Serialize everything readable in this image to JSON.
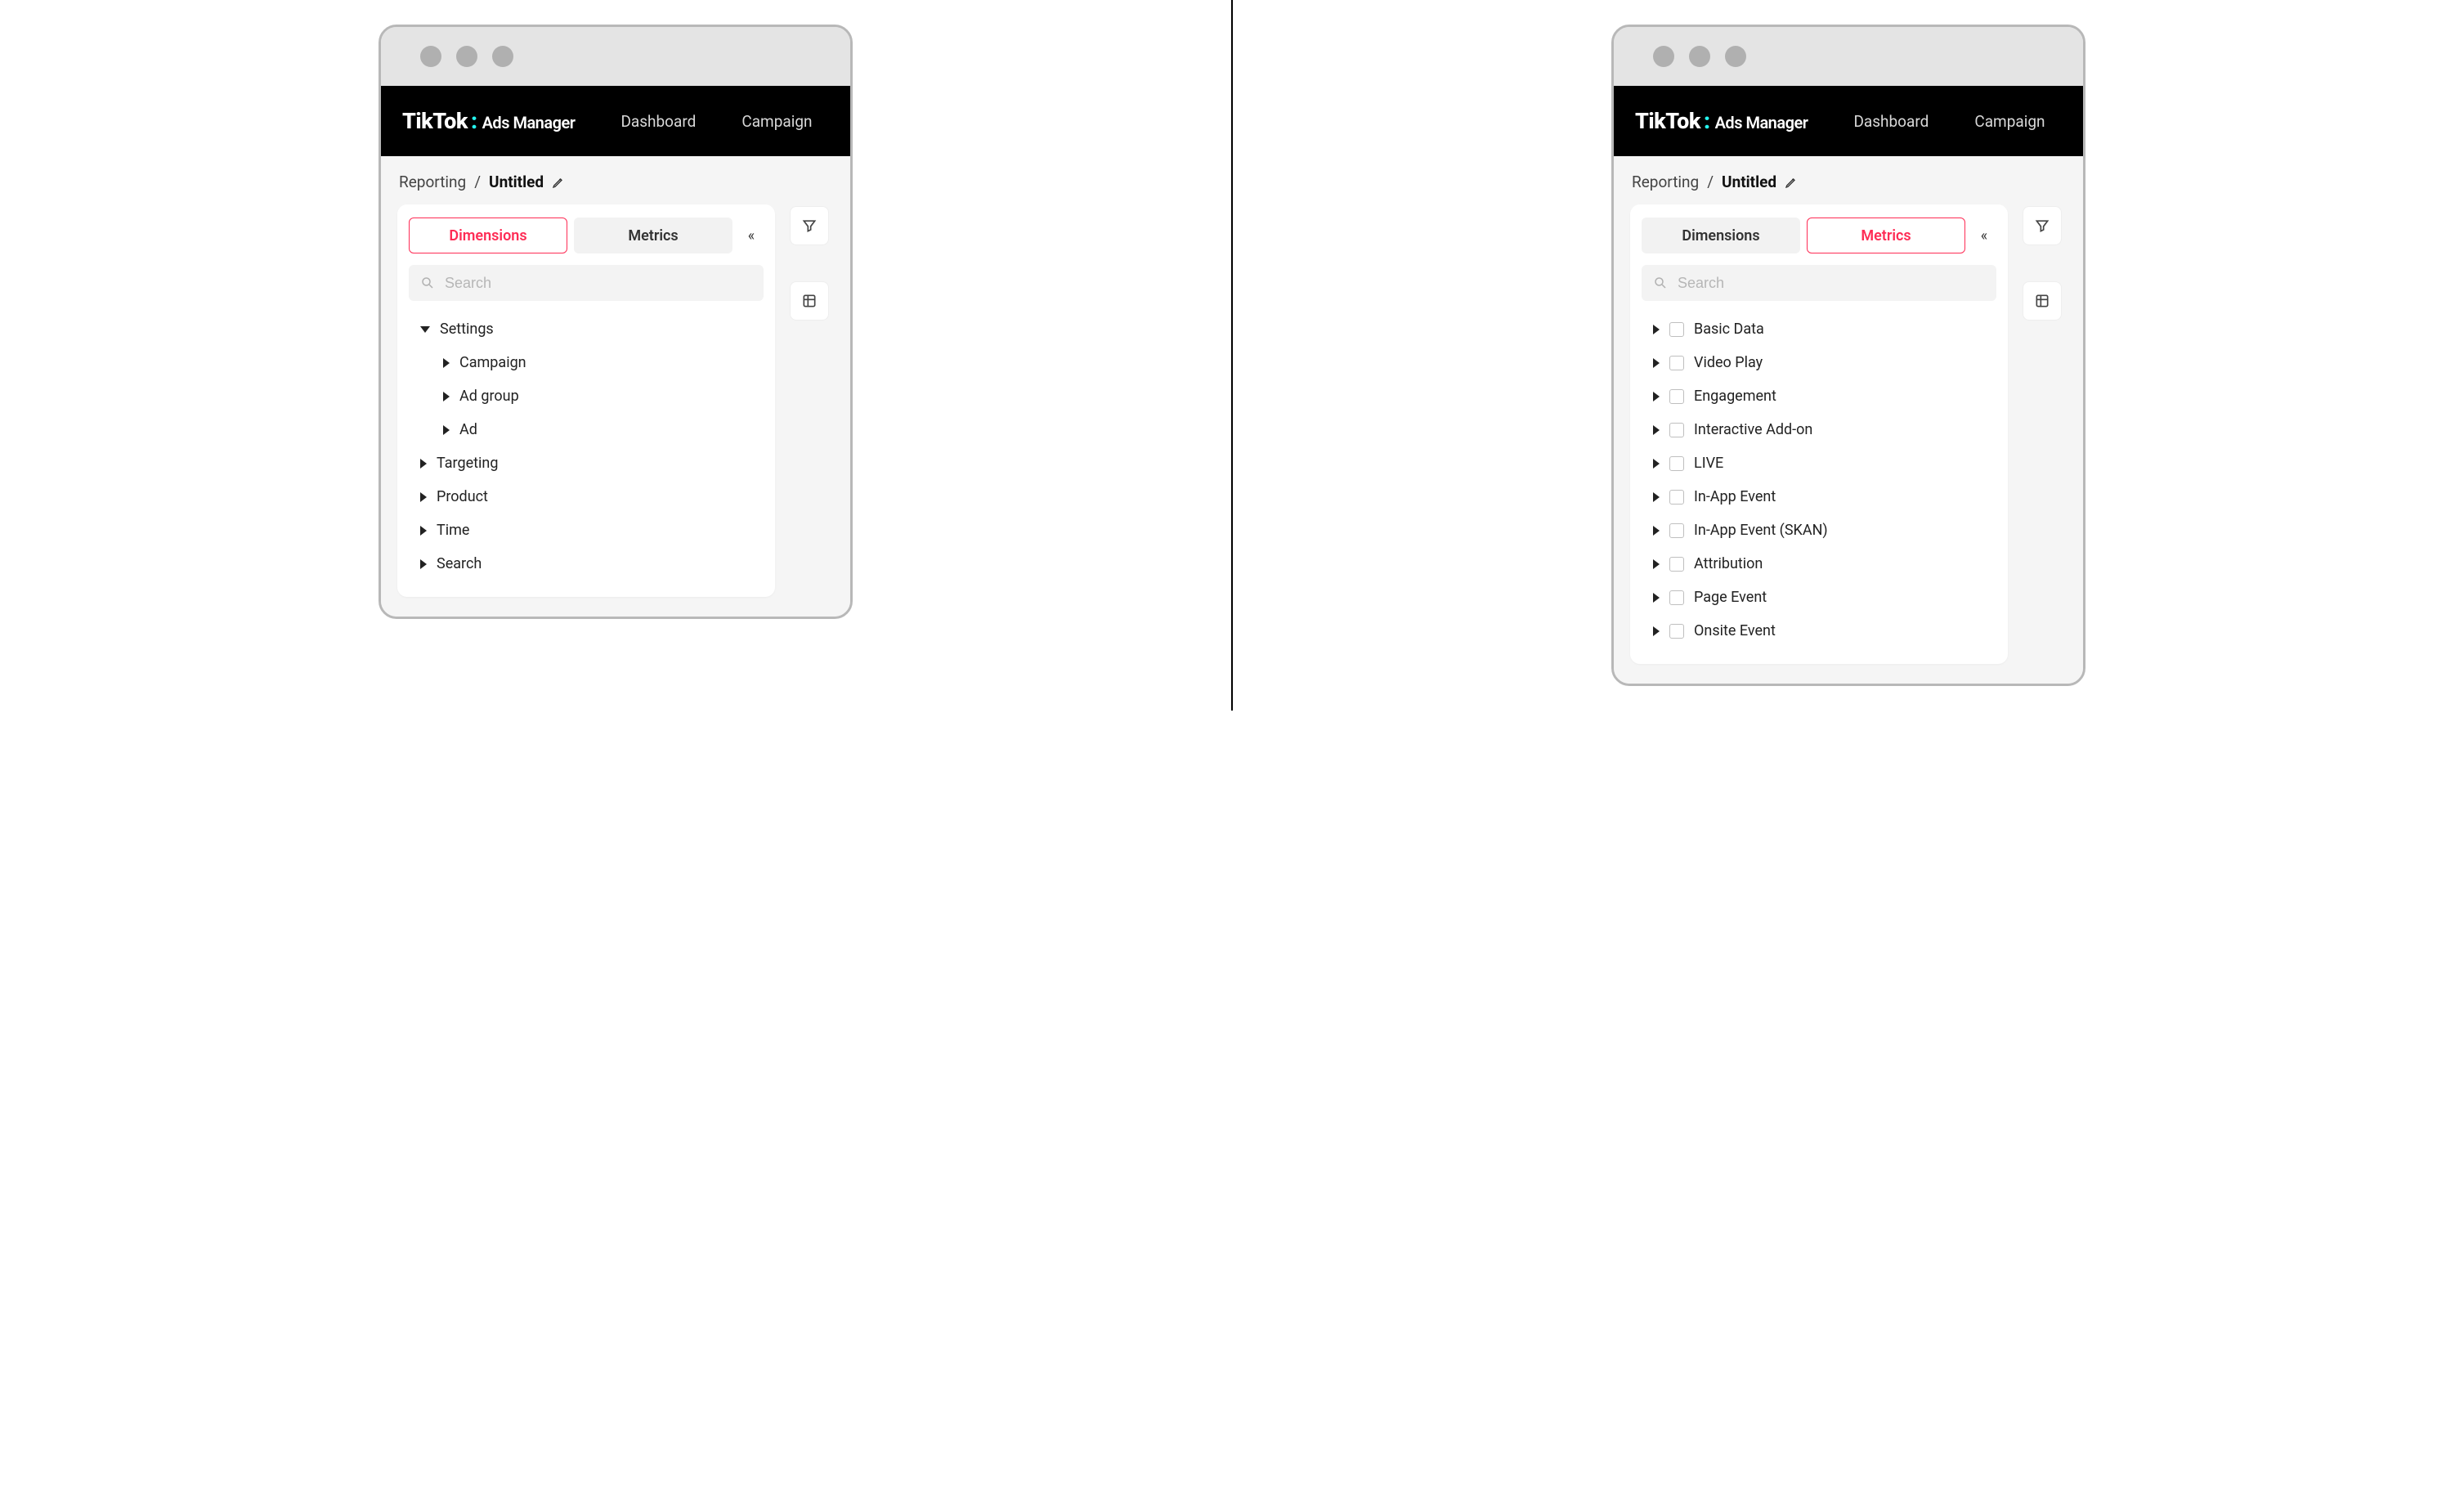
{
  "brand": {
    "name": "TikTok",
    "tail": "Ads Manager"
  },
  "nav": {
    "dashboard": "Dashboard",
    "campaign": "Campaign"
  },
  "crumb": {
    "root": "Reporting",
    "sep": "/",
    "title": "Untitled"
  },
  "tabs": {
    "dimensions": "Dimensions",
    "metrics": "Metrics"
  },
  "search": {
    "placeholder": "Search"
  },
  "left": {
    "active_tab": "dimensions",
    "tree": {
      "settings": {
        "label": "Settings",
        "expanded": true,
        "children": [
          {
            "label": "Campaign"
          },
          {
            "label": "Ad group"
          },
          {
            "label": "Ad"
          }
        ]
      },
      "rest": [
        {
          "label": "Targeting"
        },
        {
          "label": "Product"
        },
        {
          "label": "Time"
        },
        {
          "label": "Search"
        }
      ]
    }
  },
  "right": {
    "active_tab": "metrics",
    "items": [
      {
        "label": "Basic Data"
      },
      {
        "label": "Video Play"
      },
      {
        "label": "Engagement"
      },
      {
        "label": "Interactive Add-on"
      },
      {
        "label": "LIVE"
      },
      {
        "label": "In-App Event"
      },
      {
        "label": "In-App Event (SKAN)"
      },
      {
        "label": "Attribution"
      },
      {
        "label": "Page Event"
      },
      {
        "label": "Onsite Event"
      }
    ]
  }
}
